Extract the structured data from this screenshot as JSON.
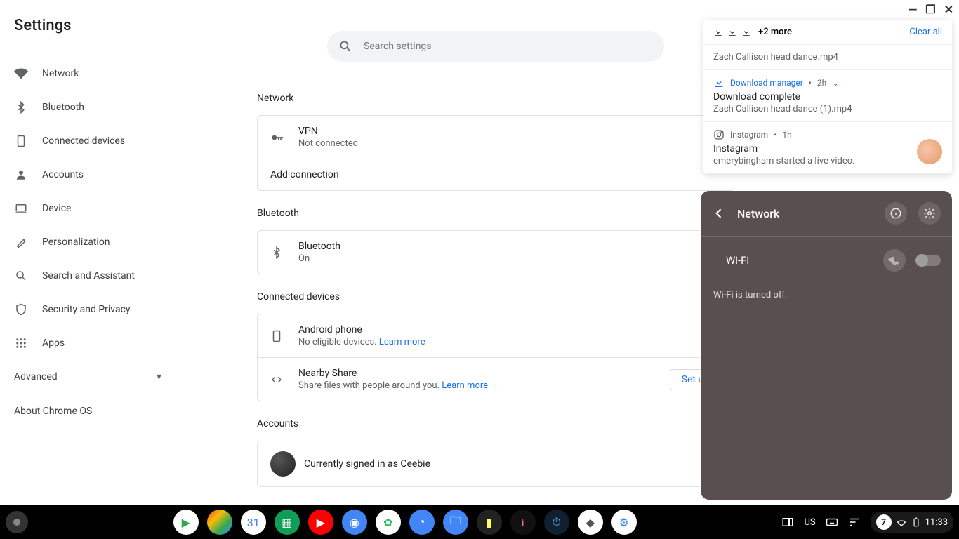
{
  "window": {
    "minimize": "—",
    "maximize": "❐",
    "close": "✕"
  },
  "settings": {
    "title": "Settings",
    "search_placeholder": "Search settings",
    "nav": {
      "network": "Network",
      "bluetooth": "Bluetooth",
      "connected": "Connected devices",
      "accounts": "Accounts",
      "device": "Device",
      "personalization": "Personalization",
      "search_assist": "Search and Assistant",
      "security": "Security and Privacy",
      "apps": "Apps",
      "advanced": "Advanced",
      "about": "About Chrome OS"
    },
    "sections": {
      "network": {
        "title": "Network",
        "vpn": {
          "title": "VPN",
          "status": "Not connected"
        },
        "add": "Add connection"
      },
      "bluetooth": {
        "title": "Bluetooth",
        "row": {
          "title": "Bluetooth",
          "status": "On"
        }
      },
      "connected": {
        "title": "Connected devices",
        "android": {
          "title": "Android phone",
          "sub": "No eligible devices. ",
          "learn": "Learn more"
        },
        "nearby": {
          "title": "Nearby Share",
          "sub": "Share files with people around you. ",
          "learn": "Learn more",
          "btn": "Set up"
        }
      },
      "accounts": {
        "title": "Accounts",
        "signed_in": "Currently signed in as Ceebie"
      }
    }
  },
  "notifications": {
    "more": "+2 more",
    "clear": "Clear all",
    "top_file": "Zach Callison head dance.mp4",
    "items": [
      {
        "source": "Download manager",
        "time": "2h",
        "title": "Download complete",
        "sub": "Zach Callison head dance (1).mp4",
        "link_source": true
      },
      {
        "source": "Instagram",
        "time": "1h",
        "title": "Instagram",
        "sub": "emerybingham started a live video.",
        "avatar": true
      }
    ]
  },
  "quick_settings": {
    "title": "Network",
    "wifi_label": "Wi-Fi",
    "wifi_msg": "Wi-Fi is turned off."
  },
  "shelf": {
    "apps": [
      {
        "name": "play-store",
        "bg": "#ffffff",
        "glyph": "▶",
        "fg": "#34a853"
      },
      {
        "name": "chrome",
        "bg": "linear-gradient(135deg,#ea4335,#fbbc05,#34a853,#4285f4)",
        "glyph": "",
        "fg": "#fff"
      },
      {
        "name": "calendar",
        "bg": "#ffffff",
        "glyph": "31",
        "fg": "#4285f4"
      },
      {
        "name": "sheets",
        "bg": "#0f9d58",
        "glyph": "▦",
        "fg": "#fff"
      },
      {
        "name": "youtube",
        "bg": "#ff0000",
        "glyph": "▶",
        "fg": "#fff"
      },
      {
        "name": "camera",
        "bg": "#4285f4",
        "glyph": "◉",
        "fg": "#fff"
      },
      {
        "name": "evernote",
        "bg": "#ffffff",
        "glyph": "✿",
        "fg": "#2dbe60"
      },
      {
        "name": "clock",
        "bg": "#4285f4",
        "glyph": "◔",
        "fg": "#fff"
      },
      {
        "name": "files",
        "bg": "#4285f4",
        "glyph": "🗀",
        "fg": "#fff"
      },
      {
        "name": "app-a",
        "bg": "#222",
        "glyph": "▮",
        "fg": "#ff6"
      },
      {
        "name": "ibis",
        "bg": "#111",
        "glyph": "i",
        "fg": "#f6a"
      },
      {
        "name": "app-b",
        "bg": "#102030",
        "glyph": "⏱",
        "fg": "#6cf"
      },
      {
        "name": "roblox",
        "bg": "#ffffff",
        "glyph": "◆",
        "fg": "#555"
      },
      {
        "name": "settings",
        "bg": "#ffffff",
        "glyph": "⚙",
        "fg": "#4285f4"
      }
    ],
    "tray": {
      "ime": "US",
      "notif_count": "7",
      "time": "11:33"
    }
  }
}
